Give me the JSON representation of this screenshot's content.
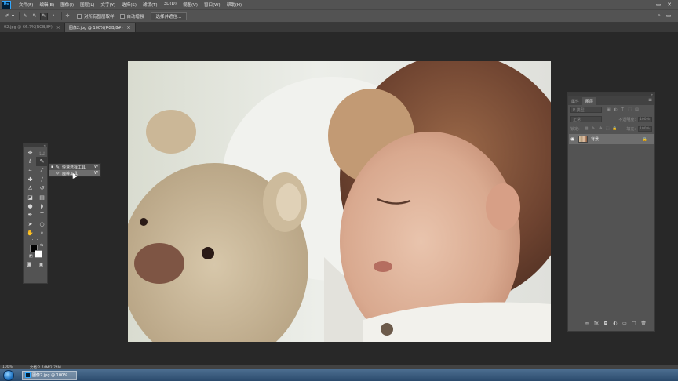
{
  "app": {
    "logo_text": "Ps"
  },
  "menu": [
    "文件(F)",
    "编辑(E)",
    "图像(I)",
    "图层(L)",
    "文字(Y)",
    "选择(S)",
    "滤镜(T)",
    "3D(D)",
    "视图(V)",
    "窗口(W)",
    "帮助(H)"
  ],
  "window_controls": {
    "minimize": "—",
    "restore": "▭",
    "close": "✕"
  },
  "options_bar": {
    "sample_all_layers": "对所有图层取样",
    "auto_enhance": "自动增强",
    "select_subject": "选择并遮住..."
  },
  "tabs": [
    {
      "label": "02.jpg @ 66.7%(RGB/8*)",
      "active": false,
      "close": "×"
    },
    {
      "label": "图像2.jpg @ 100%(RGB/8#)",
      "active": true,
      "close": "×"
    }
  ],
  "tool_flyout": {
    "items": [
      {
        "bullet": "▪",
        "label": "快速选择工具",
        "shortcut": "W",
        "selected": false
      },
      {
        "bullet": "",
        "label": "魔棒工具",
        "shortcut": "W",
        "selected": true
      }
    ]
  },
  "colors": {
    "foreground": "#000000",
    "background": "#ffffff"
  },
  "layers_panel": {
    "tabs": [
      "属性",
      "图层"
    ],
    "search_placeholder": "P 类型",
    "blend_mode": "正常",
    "opacity_label": "不透明度:",
    "opacity_value": "100%",
    "lock_label": "锁定:",
    "fill_label": "填充:",
    "fill_value": "100%",
    "layer": {
      "name": "背景"
    }
  },
  "status": {
    "zoom": "100%",
    "doc_size": "文档:2.74M/2.74M"
  },
  "taskbar": {
    "item_label": "图像2.jpg @ 100%..."
  }
}
